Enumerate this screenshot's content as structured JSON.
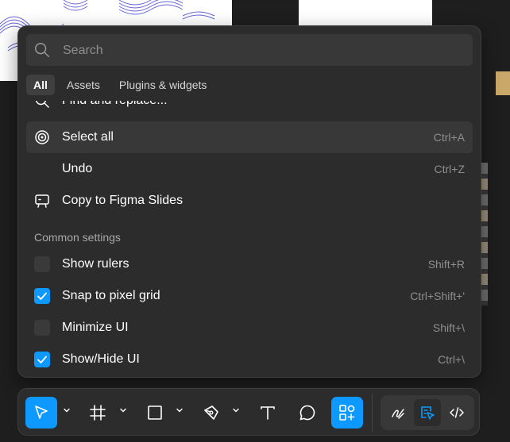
{
  "search": {
    "placeholder": "Search",
    "value": ""
  },
  "tabs": [
    {
      "label": "All",
      "active": true
    },
    {
      "label": "Assets",
      "active": false
    },
    {
      "label": "Plugins & widgets",
      "active": false
    }
  ],
  "commands": [
    {
      "label": "Find and replace...",
      "icon": "search-icon",
      "shortcut": ""
    },
    {
      "label": "Select all",
      "icon": "target-icon",
      "shortcut": "Ctrl+A",
      "highlighted": true
    },
    {
      "label": "Undo",
      "icon": "",
      "shortcut": "Ctrl+Z"
    },
    {
      "label": "Copy to Figma Slides",
      "icon": "slides-icon",
      "shortcut": ""
    }
  ],
  "common_settings": {
    "title": "Common settings",
    "items": [
      {
        "label": "Show rulers",
        "checked": false,
        "shortcut": "Shift+R"
      },
      {
        "label": "Snap to pixel grid",
        "checked": true,
        "shortcut": "Ctrl+Shift+'"
      },
      {
        "label": "Minimize UI",
        "checked": false,
        "shortcut": "Shift+\\"
      },
      {
        "label": "Show/Hide UI",
        "checked": true,
        "shortcut": "Ctrl+\\"
      }
    ]
  },
  "toolbar": {
    "tools": [
      "move-icon",
      "frame-icon",
      "rectangle-icon",
      "pen-icon",
      "text-icon",
      "comment-icon",
      "actions-icon"
    ],
    "active_tool": "move-icon",
    "modes": [
      "draw-mode-icon",
      "design-mode-icon",
      "dev-mode-icon"
    ],
    "active_mode": "design-mode-icon"
  },
  "colors": {
    "accent": "#0d99ff",
    "panel": "#2c2c2c",
    "canvas": "#1e1e1e"
  }
}
